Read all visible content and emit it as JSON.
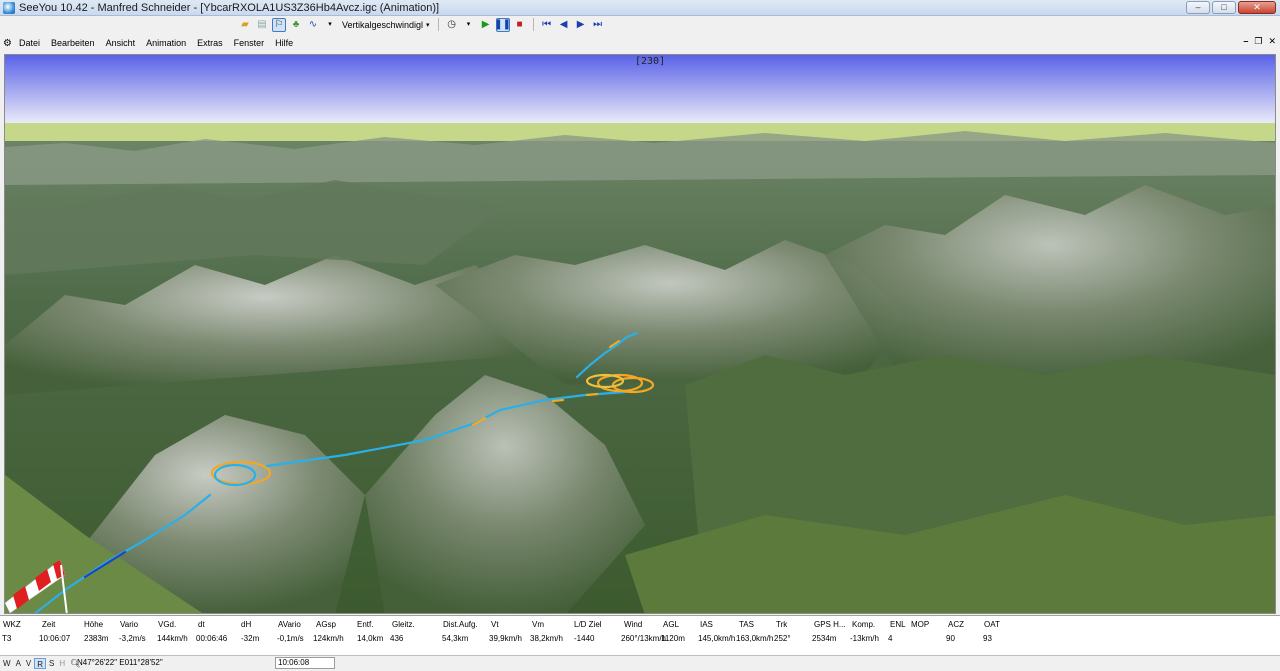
{
  "window": {
    "title": "SeeYou 10.42 - Manfred Schneider - [YbcarRXOLA1US3Z36Hb4Avcz.igc (Animation)]",
    "minimize": "–",
    "maximize": "□",
    "close": "✕"
  },
  "toolbar": {
    "vario_select": "Vertikalgeschwindigl"
  },
  "menu": {
    "items": [
      "Datei",
      "Bearbeiten",
      "Ansicht",
      "Animation",
      "Extras",
      "Fenster",
      "Hilfe"
    ],
    "mdi_minimize": "–",
    "mdi_restore": "❐",
    "mdi_close": "✕"
  },
  "viewport": {
    "frame_counter": "[230]",
    "colors": {
      "sky_top": "#5a62e8",
      "sky_bottom": "#eeeef8",
      "horizon": "#c5d88a",
      "track_climb": "#f5a623",
      "track_glide": "#2ab0e8"
    }
  },
  "data_panel": {
    "headers": [
      "WKZ",
      "Zeit",
      "Höhe",
      "Vario",
      "VGd.",
      "dt",
      "dH",
      "AVario",
      "AGsp",
      "Entf.",
      "Gleitz.",
      "Dist.Aufg.",
      "Vt",
      "Vm",
      "L/D Ziel",
      "Wind",
      "AGL",
      "IAS",
      "TAS",
      "Trk",
      "GPS H...",
      "Komp.",
      "ENL",
      "MOP",
      "ACZ",
      "OAT"
    ],
    "values": [
      "T3",
      "10:06:07",
      "2383m",
      "-3,2m/s",
      "144km/h",
      "00:06:46",
      "-32m",
      "-0,1m/s",
      "124km/h",
      "14,0km",
      "436",
      "54,3km",
      "39,9km/h",
      "38,2km/h",
      "-1440",
      "260°/13km/h",
      "1120m",
      "145,0km/h",
      "163,0km/h",
      "252°",
      "2534m",
      "-13km/h",
      "4",
      "",
      "90",
      "93"
    ]
  },
  "status": {
    "buttons": [
      "W",
      "A",
      "V",
      "R",
      "S",
      "H"
    ],
    "active_button": "R",
    "coords": "N47°26'22\"  E011°28'52\"",
    "time": "10:06:08"
  }
}
